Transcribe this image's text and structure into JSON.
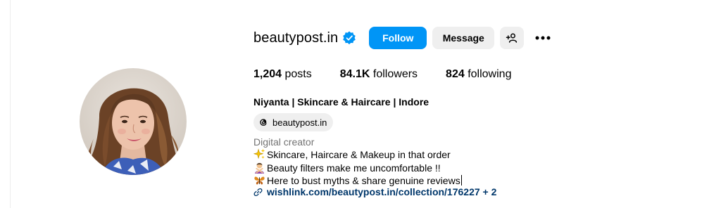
{
  "profile": {
    "username": "beautypost.in",
    "verified": true,
    "accent_color": "#0095f6"
  },
  "actions": {
    "follow_label": "Follow",
    "message_label": "Message"
  },
  "stats": [
    {
      "value": "1,204",
      "label": "posts"
    },
    {
      "value": "84.1K",
      "label": "followers"
    },
    {
      "value": "824",
      "label": "following"
    }
  ],
  "bio": {
    "full_name": "Niyanta | Skincare & Haircare | Indore",
    "threads_handle": "beautypost.in",
    "category": "Digital creator",
    "lines": [
      {
        "icon": "sparkles-icon",
        "text": "Skincare, Haircare & Makeup in that order"
      },
      {
        "icon": "woman-gesturing-no-icon",
        "text": "Beauty filters make me uncomfortable !!"
      },
      {
        "icon": "butterfly-icon",
        "text": "Here to bust myths & share genuine reviews"
      }
    ],
    "link_text": "wishlink.com/beautypost.in/collection/176227",
    "link_extra": " + 2"
  }
}
